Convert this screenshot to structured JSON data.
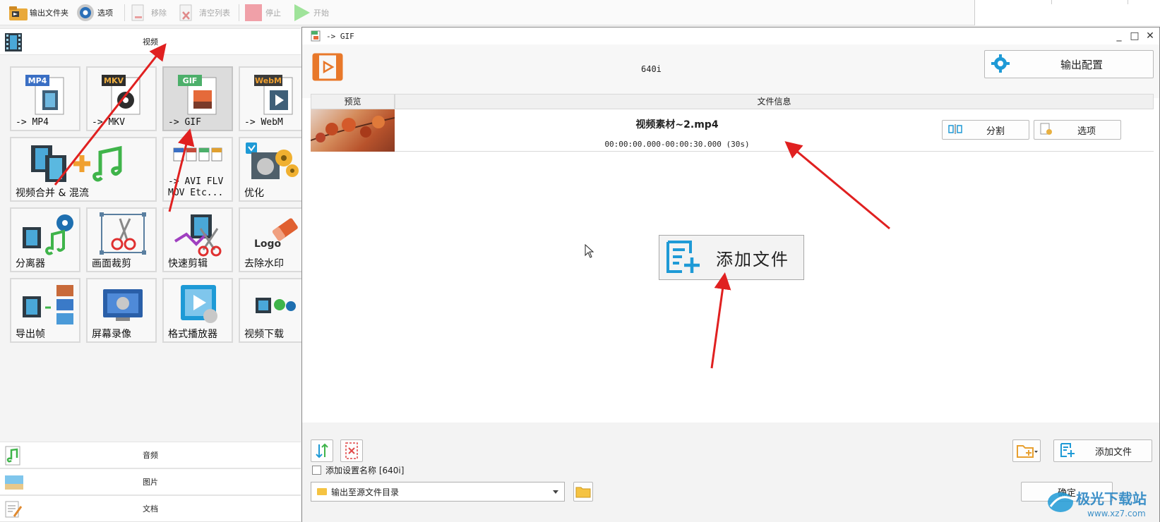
{
  "toolbar": {
    "output_folder": "输出文件夹",
    "options": "选项",
    "remove": "移除",
    "clear_list": "清空列表",
    "stop": "停止",
    "start": "开始"
  },
  "left_panel": {
    "video_category": "视频",
    "tiles": [
      {
        "badge": "MP4",
        "label": "-> MP4"
      },
      {
        "badge": "MKV",
        "label": "-> MKV"
      },
      {
        "badge": "GIF",
        "label": "-> GIF",
        "selected": true
      },
      {
        "badge": "WebM",
        "label": "-> WebM"
      },
      {
        "label": "视频合并 & 混流"
      },
      {
        "label": "-> AVI FLV\nMOV Etc..."
      },
      {
        "label": "优化"
      },
      {
        "label": "分离器"
      },
      {
        "label": "画面裁剪"
      },
      {
        "label": "快速剪辑"
      },
      {
        "label": "去除水印",
        "logo_text": "Logo"
      },
      {
        "label": "导出帧"
      },
      {
        "label": "屏幕录像"
      },
      {
        "label": "格式播放器"
      },
      {
        "label": "视频下载"
      }
    ],
    "audio_category": "音频",
    "image_category": "图片",
    "document_category": "文档"
  },
  "dialog": {
    "title": "-> GIF",
    "preset": "640i",
    "output_config_button": "输出配置",
    "columns": {
      "preview": "预览",
      "file_info": "文件信息"
    },
    "file": {
      "name": "视频素材~2.mp4",
      "time_range": "00:00:00.000-00:00:30.000 (30s)"
    },
    "split_button": "分割",
    "options_button": "选项",
    "add_file_center": "添加文件",
    "add_file_button": "添加文件",
    "add_setting_name_label": "添加设置名称 [640i]",
    "output_dir": "输出至源文件目录",
    "ok_button": "确定"
  },
  "watermark": {
    "brand": "极光下载站",
    "url": "www.xz7.com"
  },
  "colors": {
    "accent_orange": "#e8782a",
    "accent_blue": "#1e9ad6",
    "arrow_red": "#e02020"
  }
}
